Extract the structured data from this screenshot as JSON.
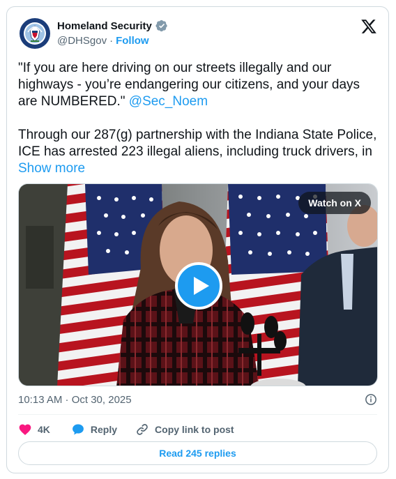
{
  "author": {
    "display_name": "Homeland Security",
    "handle": "@DHSgov",
    "separator": "·",
    "follow_label": "Follow",
    "verified": true,
    "avatar": "dhs-seal"
  },
  "tweet": {
    "quote": "\"If you are here driving on our streets illegally and our highways - you’re endangering our citizens, and your days are NUMBERED.\" ",
    "mention": "@Sec_Noem",
    "body": "Through our 287(g) partnership with the Indiana State Police, ICE has arrested 223 illegal aliens, including truck drivers, in ",
    "show_more": "Show more"
  },
  "media": {
    "watch_label": "Watch on X",
    "play_icon": "play-icon"
  },
  "meta": {
    "timestamp": "10:13 AM · Oct 30, 2025",
    "info_icon": "info-icon"
  },
  "actions": {
    "like_count": "4K",
    "reply_label": "Reply",
    "copy_label": "Copy link to post"
  },
  "read_replies": "Read 245 replies",
  "colors": {
    "accent": "#1d9bf0",
    "like": "#f91880",
    "text": "#0f1419",
    "secondary": "#536471",
    "border": "#cfd9de"
  }
}
